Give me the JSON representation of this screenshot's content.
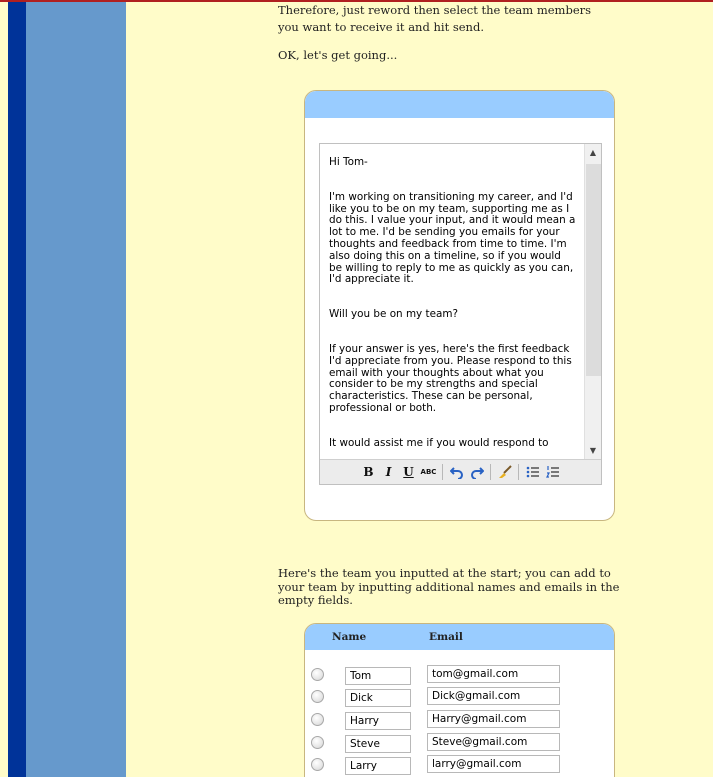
{
  "intro": {
    "line1": "Therefore, just reword then select the team members",
    "line2": "you want to receive it and hit send.",
    "ok": "OK, let's get going..."
  },
  "editor": {
    "greeting": "Hi Tom-",
    "para1": "I'm working on transitioning my career, and I'd like you to be on my team, supporting me as I do this. I value your input, and it would mean a lot to me. I'd be sending you emails for your thoughts and feedback from time to time. I'm also doing this on a timeline, so if you would be willing to reply to me as quickly as you can, I'd appreciate it.",
    "para2": "Will you be on my team?",
    "para3": "If your answer is yes, here's the first feedback I'd appreciate from you. Please respond to this email with your thoughts about what you consider to be my strengths and special characteristics. These can be personal, professional or both.",
    "para4": "It would assist me if you would respond to"
  },
  "toolbar": {
    "bold": "B",
    "italic": "I",
    "underline": "U",
    "strike": "ABC",
    "undo_icon": "undo-icon",
    "redo_icon": "redo-icon",
    "clean_icon": "broom-icon",
    "ul_icon": "bullet-list-icon",
    "ol_icon": "numbered-list-icon"
  },
  "team": {
    "intro": "Here's the team you inputted at the start; you can add to your team by inputting additional names and emails in the empty fields.",
    "col_name": "Name",
    "col_email": "Email",
    "rows": [
      {
        "name": "Tom",
        "email": "tom@gmail.com"
      },
      {
        "name": "Dick",
        "email": "Dick@gmail.com"
      },
      {
        "name": "Harry",
        "email": "Harry@gmail.com"
      },
      {
        "name": "Steve",
        "email": "Steve@gmail.com"
      },
      {
        "name": "Larry",
        "email": "larry@gmail.com"
      }
    ]
  },
  "colors": {
    "page_bg": "#fffcc9",
    "nav_dark": "#003399",
    "nav_light": "#6699cc",
    "panel_header": "#99ccff"
  }
}
